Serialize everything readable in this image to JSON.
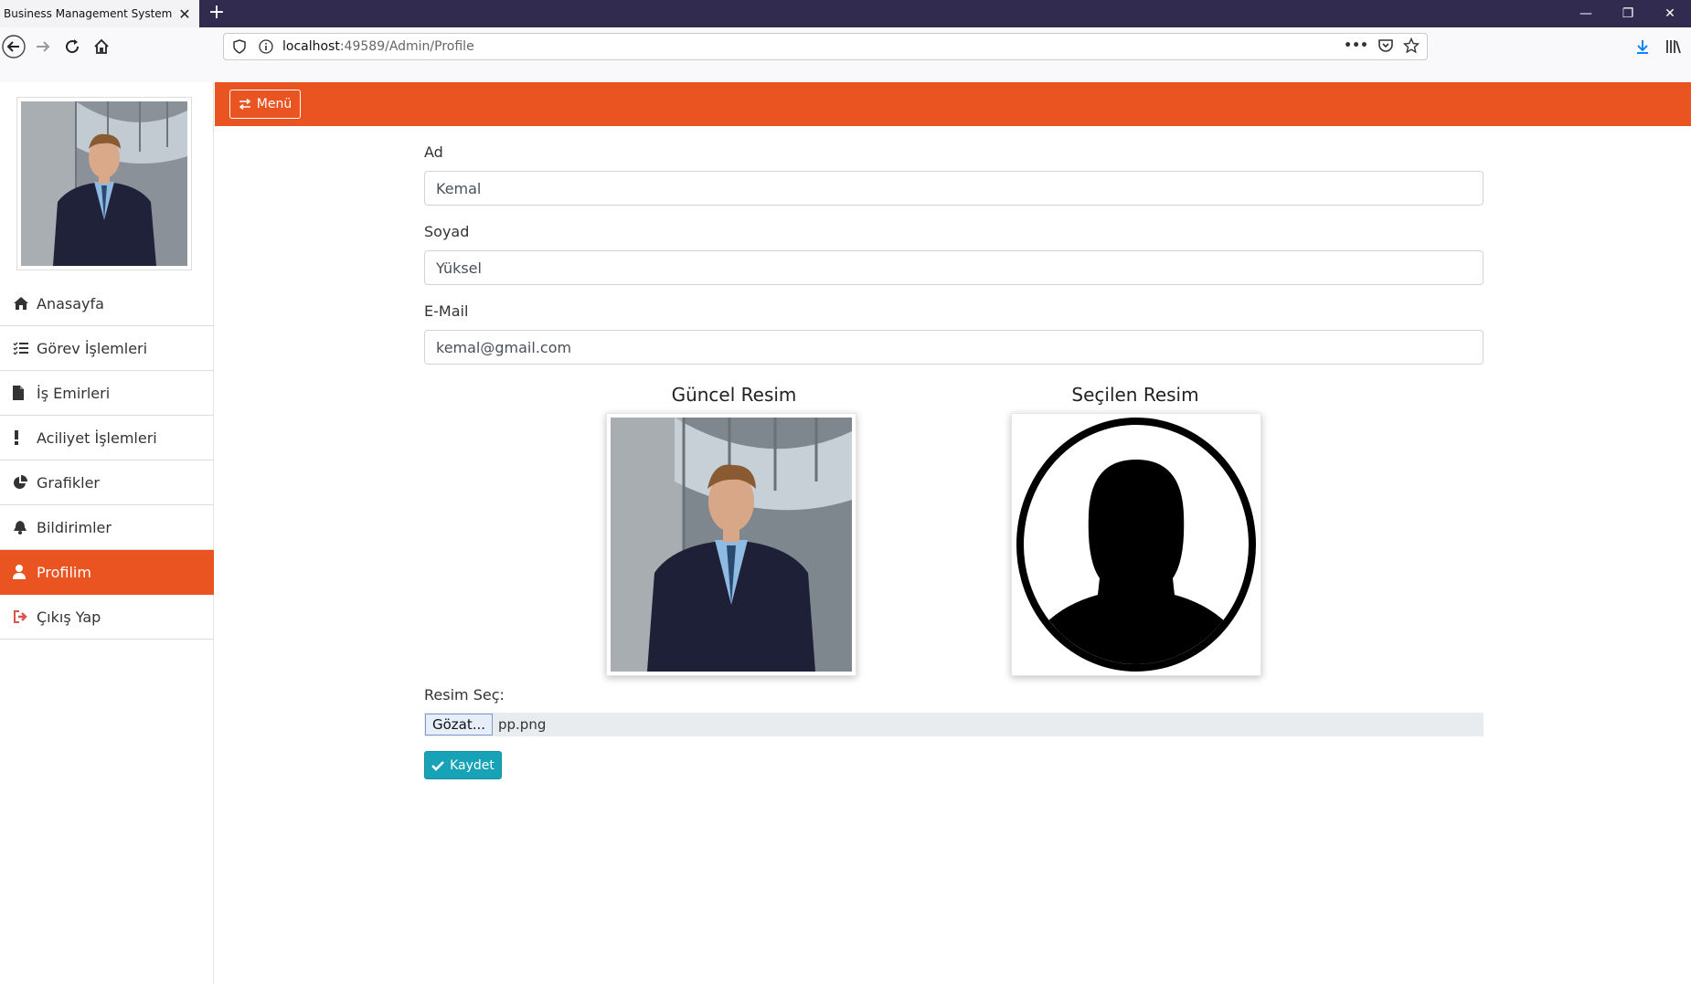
{
  "browser": {
    "tab_title": "Business Management System",
    "tab_close": "✕",
    "new_tab": "+",
    "url_host": "localhost",
    "url_path": ":49589/Admin/Profile",
    "url_more": "•••",
    "window_controls": [
      "—",
      "❐",
      "✕"
    ]
  },
  "sidebar": {
    "items": [
      {
        "label": "Anasayfa",
        "icon": "home-icon"
      },
      {
        "label": "Görev İşlemleri",
        "icon": "tasks-icon"
      },
      {
        "label": "İş Emirleri",
        "icon": "file-icon"
      },
      {
        "label": "Aciliyet İşlemleri",
        "icon": "exclamation-icon"
      },
      {
        "label": "Grafikler",
        "icon": "pie-chart-icon"
      },
      {
        "label": "Bildirimler",
        "icon": "bell-icon"
      },
      {
        "label": "Profilim",
        "icon": "user-icon"
      },
      {
        "label": "Çıkış Yap",
        "icon": "sign-out-icon"
      }
    ],
    "active_item": "Profilim"
  },
  "header": {
    "menu_label": "Menü"
  },
  "form": {
    "first_name_label": "Ad",
    "first_name_value": "Kemal",
    "last_name_label": "Soyad",
    "last_name_value": "Yüksel",
    "email_label": "E-Mail",
    "email_value": "kemal@gmail.com",
    "current_image_title": "Güncel Resim",
    "selected_image_title": "Seçilen Resim",
    "choose_image_label": "Resim Seç:",
    "browse_button": "Gözat...",
    "file_name": "pp.png",
    "save_button": "Kaydet"
  },
  "colors": {
    "accent": "#e95420",
    "save": "#17a2b8",
    "chrome_dark": "#322b50"
  }
}
